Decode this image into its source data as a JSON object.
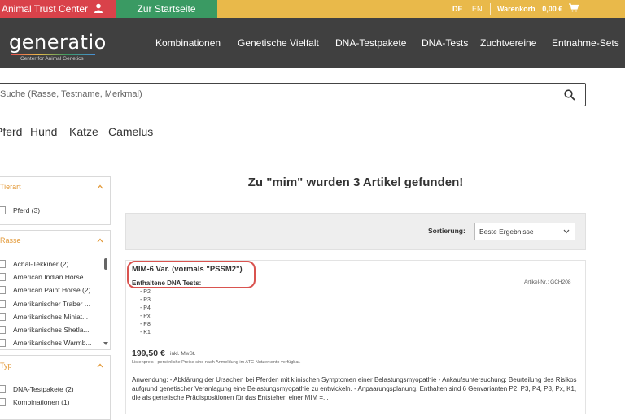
{
  "topbar": {
    "atc_label": "Animal Trust Center",
    "home_label": "Zur Startseite",
    "lang_de": "DE",
    "lang_en": "EN",
    "cart_label": "Warenkorb",
    "cart_total": "0,00 €",
    "colors": {
      "bar": "#e9b94a",
      "atc": "#d9424a",
      "home": "#3a9a63"
    }
  },
  "header": {
    "logo_text": "generatio",
    "logo_subtitle": "Center for Animal Genetics",
    "nav": [
      "Kombinationen",
      "Genetische Vielfalt",
      "DNA-Testpakete",
      "DNA-Tests",
      "Zuchtvereine",
      "Entnahme-Sets"
    ]
  },
  "search": {
    "placeholder": "Suche (Rasse, Testname, Merkmal)",
    "icon": "search-icon"
  },
  "species": [
    "Pferd",
    "Hund",
    "Katze",
    "Camelus"
  ],
  "filters": {
    "tierart": {
      "title": "Tierart",
      "items": [
        "Pferd (3)"
      ]
    },
    "rasse": {
      "title": "Rasse",
      "items": [
        "Achal-Tekkiner (2)",
        "American Indian Horse ...",
        "American Paint Horse (2)",
        "Amerikanischer Traber ...",
        "Amerikanisches Miniat...",
        "Amerikanisches Shetla...",
        "Amerikanisches Warmb..."
      ]
    },
    "typ": {
      "title": "Typ",
      "items": [
        "DNA-Testpakete (2)",
        "Kombinationen (1)"
      ]
    }
  },
  "results": {
    "title": "Zu \"mim\" wurden 3 Artikel gefunden!",
    "sort_label": "Sortierung:",
    "sort_value": "Beste Ergebnisse"
  },
  "product": {
    "name": "MIM-6 Var. (vormals \"PSSM2\")",
    "tests_label": "Enthaltene DNA Tests:",
    "article_no": "Artikel-Nr.: GCH208",
    "tests": [
      "- P2",
      "- P3",
      "- P4",
      "- Px",
      "- P8",
      "- K1"
    ],
    "price": "199,50 €",
    "price_note": "inkl. MwSt.",
    "price_hint": "Listenpreis - persönliche Preise sind nach Anmeldung im ATC-Nutzerkonto verfügbar.",
    "description": "Anwendung: - Abklärung der Ursachen bei Pferden mit klinischen Symptomen einer Belastungsmyopathie - Ankaufsuntersuchung: Beurteilung des Risikos aufgrund genetischer Veranlagung eine Belastungsmyopathie zu entwickeln. - Anpaarungsplanung. Enthalten sind 6 Genvarianten P2, P3, P4, P8, Px, K1, die als genetische Prädispositionen für das Entstehen einer MIM =...",
    "highlight_color": "#d9534f"
  }
}
